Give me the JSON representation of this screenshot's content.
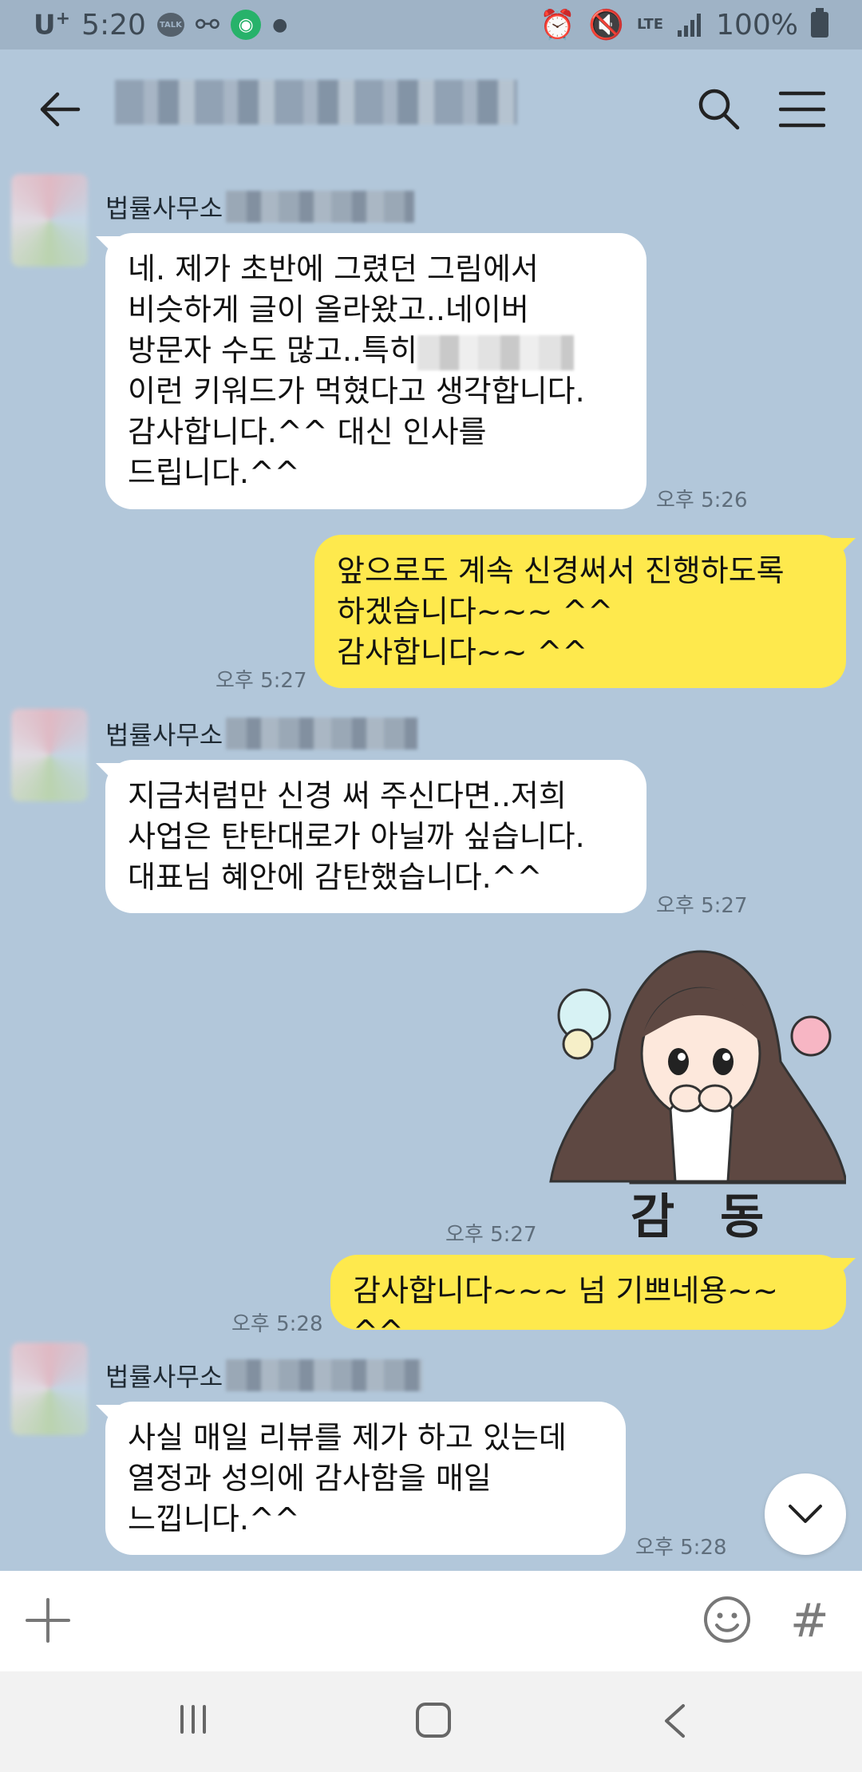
{
  "status_bar": {
    "carrier": "U",
    "carrier_plus": "+",
    "time": "5:20",
    "talk_badge": "TALK",
    "lte": "LTE",
    "battery": "100%"
  },
  "header": {
    "title": ""
  },
  "messages": [
    {
      "type": "in",
      "sender": "법률사무소",
      "text": "네. 제가 초반에 그렸던 그림에서\n비슷하게 글이 올라왔고..네이버\n방문자 수도 많고..특히",
      "text_after": "이런 키워드가 먹혔다고 생각합니다.\n감사합니다.^^ 대신 인사를\n드립니다.^^",
      "time": "오후 5:26"
    },
    {
      "type": "out",
      "text": "앞으로도 계속 신경써서 진행하도록\n하겠습니다~~~ ^^\n감사합니다~~ ^^",
      "time": "오후 5:27"
    },
    {
      "type": "in",
      "sender": "법률사무소",
      "text": "지금처럼만 신경 써 주신다면..저희\n사업은 탄탄대로가 아닐까 싶습니다.\n대표님 혜안에 감탄했습니다.^^",
      "time": "오후 5:27"
    },
    {
      "type": "sticker",
      "caption": "감 동",
      "time": "오후 5:27"
    },
    {
      "type": "out",
      "text": "감사합니다~~~ 넘 기쁘네용~~ ^^",
      "time": "오후 5:28"
    },
    {
      "type": "in",
      "sender": "법률사무소",
      "text": "사실 매일 리뷰를 제가 하고 있는데\n열정과 성의에 감사함을 매일\n느낍니다.^^",
      "time": "오후 5:28"
    }
  ],
  "input": {
    "hash": "#"
  },
  "colors": {
    "chat_bg": "#b2c7da",
    "outgoing_bubble": "#fee94d",
    "incoming_bubble": "#ffffff"
  },
  "icons": [
    "back-arrow-icon",
    "search-icon",
    "menu-icon",
    "chevron-down-icon",
    "plus-icon",
    "emoji-icon",
    "hash-icon",
    "recents-icon",
    "home-icon",
    "nav-back-icon"
  ]
}
